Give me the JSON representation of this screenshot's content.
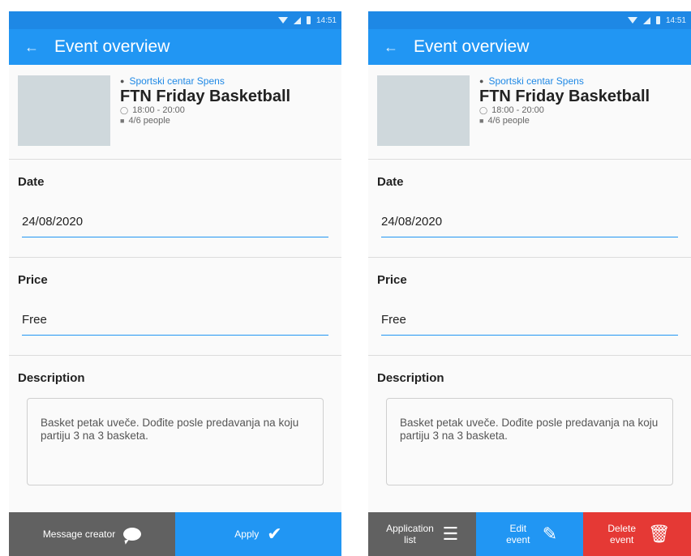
{
  "status_bar": {
    "time": "14:51"
  },
  "app_bar": {
    "back_icon": "arrow-back-icon",
    "title": "Event overview"
  },
  "event": {
    "location": "Sportski centar Spens",
    "title": "FTN Friday Basketball",
    "time": "18:00 - 20:00",
    "people": "4/6 people"
  },
  "date": {
    "label": "Date",
    "value": "24/08/2020"
  },
  "price": {
    "label": "Price",
    "value": "Free"
  },
  "description": {
    "label": "Description",
    "text": "Basket petak uveče. Dođite posle predavanja na koju partiju 3 na 3 basketa."
  },
  "left_actions": {
    "message_creator": "Message creator",
    "apply": "Apply"
  },
  "right_actions": {
    "application_list": "Application list",
    "edit_event": "Edit event",
    "delete_event": "Delete event"
  },
  "colors": {
    "primary": "#2196f3",
    "status": "#1e88e5",
    "grey_button": "#616161",
    "delete_button": "#e53935"
  }
}
